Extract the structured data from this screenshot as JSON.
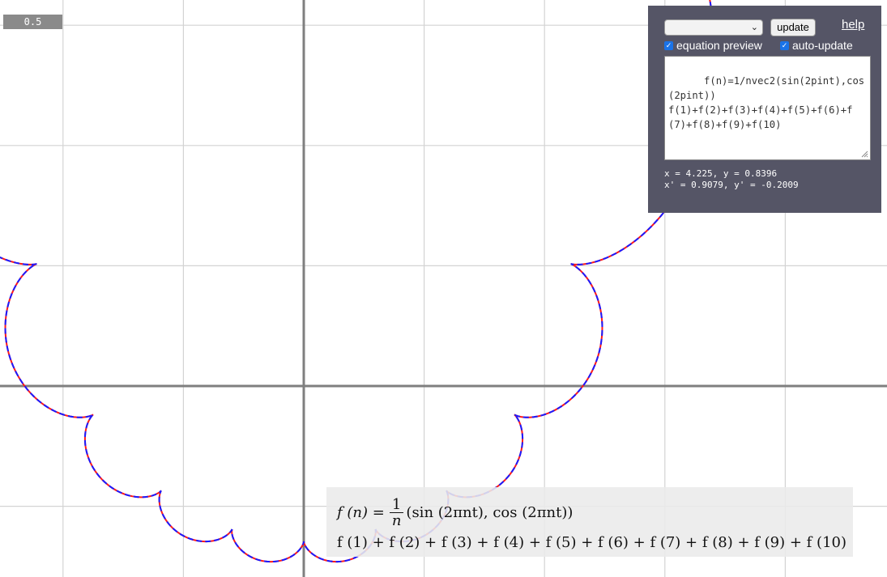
{
  "toolbar": {
    "scale_label": "0.5",
    "preset_select_value": "",
    "update_label": "update",
    "help_label": "help"
  },
  "options": {
    "equation_preview": {
      "label": "equation preview",
      "checked": true
    },
    "auto_update": {
      "label": "auto-update",
      "checked": true
    }
  },
  "editor": {
    "text": "f(n)=1/nvec2(sin(2pint),cos(2pint))\nf(1)+f(2)+f(3)+f(4)+f(5)+f(6)+f(7)+f(8)+f(9)+f(10)"
  },
  "readout": {
    "line1": "x = 4.225, y = 0.8396",
    "line2": "x' = 0.9079, y' = -0.2009"
  },
  "preview": {
    "lhs": "f (n) =",
    "frac_num": "1",
    "frac_den": "n",
    "rhs": "(sin (2πnt), cos (2πnt))",
    "line2": "f (1) + f (2) + f (3) + f (4) + f (5) + f (6) + f (7) + f (8) + f (9) + f (10)"
  },
  "plot": {
    "grid_spacing_units": 0.5,
    "terms": 10,
    "curve_colors": {
      "primary": "#ff1a1a",
      "secondary": "#1a1aff"
    },
    "axis_color": "#7f7f7f",
    "grid_color": "#d3d3d3"
  }
}
